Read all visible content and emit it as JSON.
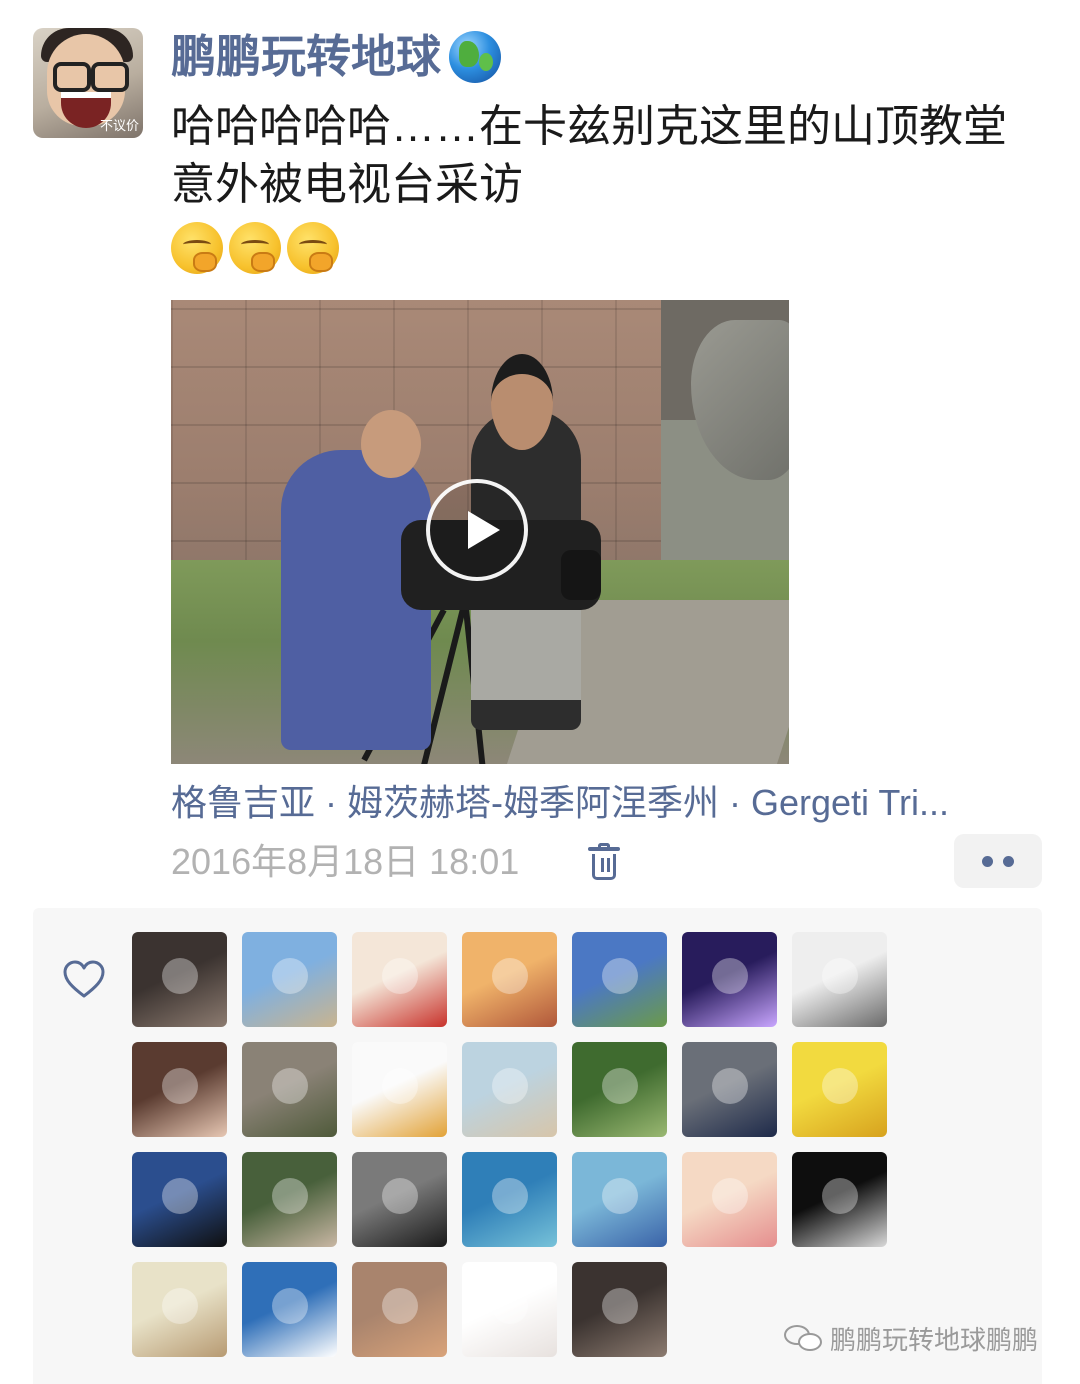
{
  "post": {
    "username": "鹏鹏玩转地球",
    "username_emoji": "earth-africa-emoji",
    "avatar_caption": "不议价",
    "text_line1": "哈哈哈哈哈……在卡兹别克这里的山顶教堂",
    "text_line2": "意外被电视台采访",
    "emoji_reactions": [
      "thinking-face-emoji",
      "thinking-face-emoji",
      "thinking-face-emoji"
    ],
    "location": "格鲁吉亚 · 姆茨赫塔-姆季阿涅季州 · Gergeti Tri...",
    "timestamp": "2016年8月18日 18:01"
  },
  "media": {
    "type": "video",
    "description_icon": "play-icon"
  },
  "actions": {
    "delete_icon": "trash-icon",
    "more_icon": "more-dots-icon"
  },
  "likes": {
    "icon": "heart-icon",
    "count": 26
  },
  "watermark": {
    "text": "鹏鹏玩转地球鹏鹏",
    "icon": "wechat-icon"
  },
  "colors": {
    "link": "#576b95",
    "timestamp": "#b2b2b2",
    "panel_bg": "#f7f7f7"
  }
}
